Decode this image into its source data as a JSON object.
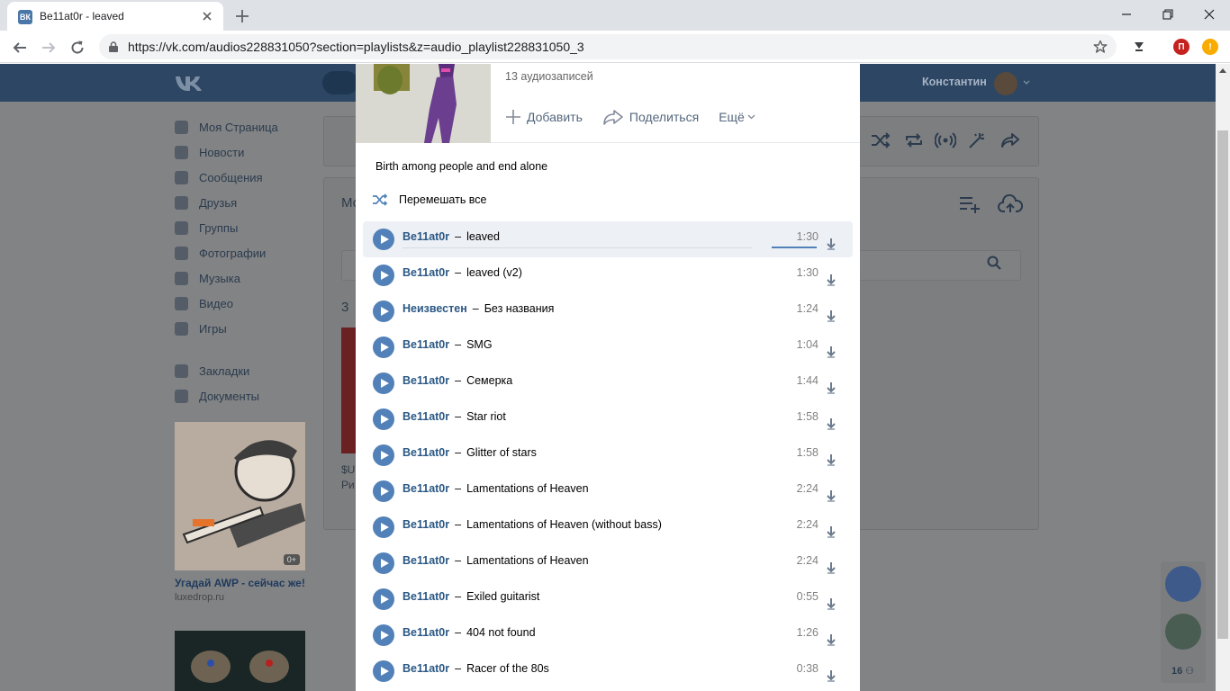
{
  "browser": {
    "tab_title": "Be11at0r - leaved",
    "tab_favicon": "ВК",
    "url": "https://vk.com/audios228831050?section=playlists&z=audio_playlist228831050_3",
    "ext_profile_letter": "П",
    "ext_alert_letter": "!"
  },
  "vk": {
    "user_name": "Константин",
    "sidebar": [
      {
        "label": "Моя Страница",
        "icon": "home-icon"
      },
      {
        "label": "Новости",
        "icon": "news-icon"
      },
      {
        "label": "Сообщения",
        "icon": "messages-icon"
      },
      {
        "label": "Друзья",
        "icon": "friends-icon"
      },
      {
        "label": "Группы",
        "icon": "groups-icon"
      },
      {
        "label": "Фотографии",
        "icon": "photos-icon"
      },
      {
        "label": "Музыка",
        "icon": "music-icon"
      },
      {
        "label": "Видео",
        "icon": "video-icon"
      },
      {
        "label": "Игры",
        "icon": "games-icon"
      },
      {
        "label": "Закладки",
        "icon": "bookmarks-icon"
      },
      {
        "label": "Документы",
        "icon": "documents-icon"
      }
    ],
    "ad": {
      "title": "Угадай AWP - сейчас же!",
      "domain": "luxedrop.ru",
      "age": "0+"
    },
    "bg_fragments": {
      "mo": "Мо",
      "three": "3",
      "su": "$U",
      "ri": "Ри"
    },
    "friends_count": "16"
  },
  "playlist": {
    "count_text": "13 аудиозаписей",
    "add_label": "Добавить",
    "share_label": "Поделиться",
    "more_label": "Ещё",
    "description": "Birth among people and end alone",
    "shuffle_label": "Перемешать все",
    "tracks": [
      {
        "artist": "Be11at0r",
        "title": "leaved",
        "duration": "1:30"
      },
      {
        "artist": "Be11at0r",
        "title": "leaved (v2)",
        "duration": "1:30"
      },
      {
        "artist": "Неизвестен",
        "title": "Без названия",
        "duration": "1:24"
      },
      {
        "artist": "Be11at0r",
        "title": "SMG",
        "duration": "1:04"
      },
      {
        "artist": "Be11at0r",
        "title": "Семерка",
        "duration": "1:44"
      },
      {
        "artist": "Be11at0r",
        "title": "Star riot",
        "duration": "1:58"
      },
      {
        "artist": "Be11at0r",
        "title": "Glitter of stars",
        "duration": "1:58"
      },
      {
        "artist": "Be11at0r",
        "title": "Lamentations of Heaven",
        "duration": "2:24"
      },
      {
        "artist": "Be11at0r",
        "title": "Lamentations of Heaven (without bass)",
        "duration": "2:24"
      },
      {
        "artist": "Be11at0r",
        "title": "Lamentations of Heaven",
        "duration": "2:24"
      },
      {
        "artist": "Be11at0r",
        "title": "Exiled guitarist",
        "duration": "0:55"
      },
      {
        "artist": "Be11at0r",
        "title": "404 not found",
        "duration": "1:26"
      },
      {
        "artist": "Be11at0r",
        "title": "Racer of the 80s",
        "duration": "0:38"
      }
    ]
  },
  "colors": {
    "vk_header": "#2c4663",
    "accent": "#5181b8",
    "link": "#2a5885",
    "ext_profile": "#c5221f",
    "ext_alert": "#f9ab00"
  }
}
